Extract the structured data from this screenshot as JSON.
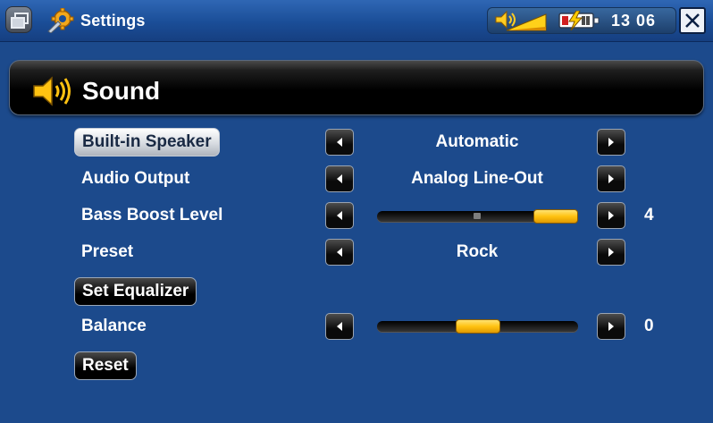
{
  "titlebar": {
    "app_icon": "settings-gear-wrench-icon",
    "title": "Settings",
    "clock": "13 06",
    "icons": {
      "window": "window-switch-icon",
      "volume": "speaker-volume-icon",
      "battery": "battery-charging-icon",
      "close": "close-icon"
    }
  },
  "header": {
    "icon": "speaker-icon",
    "title": "Sound"
  },
  "rows": {
    "builtin_speaker": {
      "label": "Built-in Speaker",
      "value": "Automatic"
    },
    "audio_output": {
      "label": "Audio Output",
      "value": "Analog Line-Out"
    },
    "bass_boost": {
      "label": "Bass Boost Level",
      "value": "4",
      "level_fraction": 1.0
    },
    "preset": {
      "label": "Preset",
      "value": "Rock"
    },
    "set_equalizer": {
      "label": "Set Equalizer"
    },
    "balance": {
      "label": "Balance",
      "value": "0",
      "level_fraction": 0.5
    },
    "reset": {
      "label": "Reset"
    }
  },
  "colors": {
    "background": "#1c4a8c",
    "accent_slider": "#ffc211",
    "header_bar": "#000000",
    "text": "#ffffff"
  }
}
